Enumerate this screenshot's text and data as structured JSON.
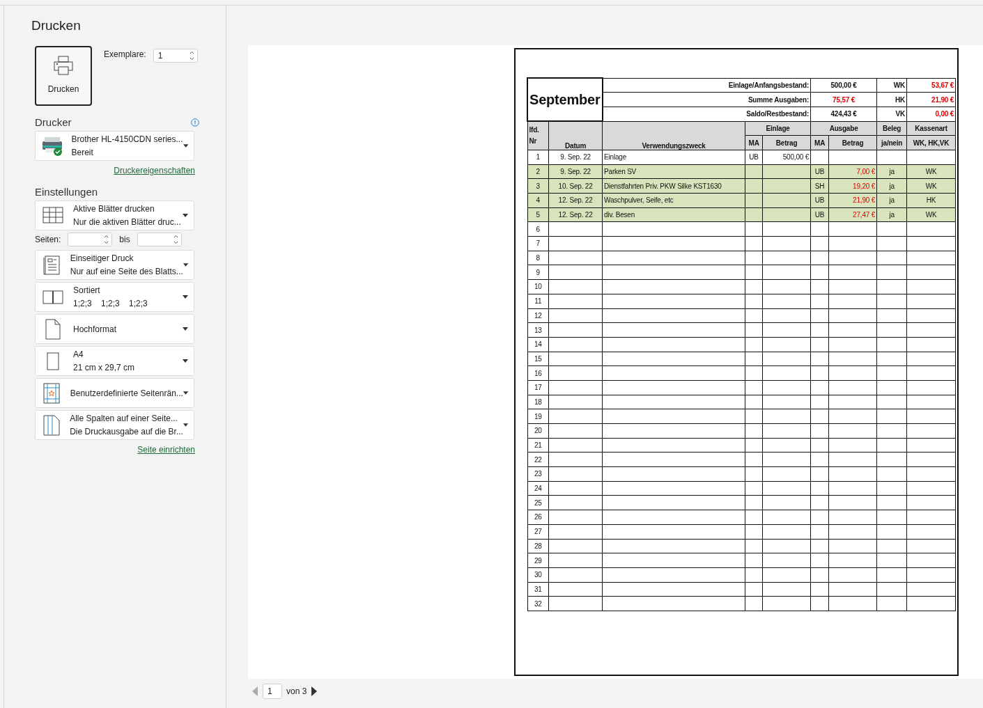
{
  "title": "Drucken",
  "print_button": {
    "label": "Drucken"
  },
  "copies": {
    "label": "Exemplare:",
    "value": "1"
  },
  "printer": {
    "heading": "Drucker",
    "name": "Brother HL-4150CDN series...",
    "status": "Bereit",
    "ready": true,
    "link": "Druckereigenschaften"
  },
  "settings": {
    "heading": "Einstellungen",
    "items": [
      {
        "kind": "sheets",
        "title": "Aktive Blätter drucken",
        "subtitle": "Nur die aktiven Blätter druc..."
      },
      {
        "kind": "pages",
        "from_label": "Seiten:",
        "to_label": "bis"
      },
      {
        "kind": "sides",
        "title": "Einseitiger Druck",
        "subtitle": "Nur auf eine Seite des Blatts..."
      },
      {
        "kind": "collate",
        "title": "Sortiert",
        "subtitle": "1;2;3    1;2;3    1;2;3"
      },
      {
        "kind": "orientation",
        "title": "Hochformat"
      },
      {
        "kind": "paper",
        "title": "A4",
        "subtitle": "21 cm x 29,7 cm"
      },
      {
        "kind": "margins",
        "title": "Benutzerdefinierte Seitenrän..."
      },
      {
        "kind": "scaling",
        "title": "Alle Spalten auf einer Seite...",
        "subtitle": "Die Druckausgabe auf die Br..."
      }
    ],
    "link": "Seite einrichten"
  },
  "sheet": {
    "month": "September",
    "summary": [
      {
        "label": "Einlage/Anfangsbestand:",
        "value": "500,00 €",
        "negative": false,
        "kasse": "WK",
        "kasse_value": "53,67 €"
      },
      {
        "label": "Summe Ausgaben:",
        "value": "75,57 €",
        "negative": true,
        "kasse": "HK",
        "kasse_value": "21,90 €"
      },
      {
        "label": "Saldo/Restbestand:",
        "value": "424,43 €",
        "negative": false,
        "kasse": "VK",
        "kasse_value": "0,00 €"
      }
    ],
    "headers": {
      "nr": "lfd. Nr",
      "datum": "Datum",
      "zweck": "Verwendungszweck",
      "einlage": "Einlage",
      "ausgabe": "Ausgabe",
      "beleg": "Beleg",
      "kassenart": "Kassenart",
      "ma": "MA",
      "betrag": "Betrag",
      "ma_2": "MA",
      "betrag_2": "Betrag",
      "janein": "ja/nein",
      "kassen": "WK, HK,VK"
    },
    "rows": [
      {
        "nr": "1",
        "datum": "9. Sep. 22",
        "zweck": "Einlage",
        "einlage_ma": "UB",
        "einlage_betrag": "500,00 €",
        "highlighted": false
      },
      {
        "nr": "2",
        "datum": "9. Sep. 22",
        "zweck": "Parken SV",
        "ausgabe_ma": "UB",
        "ausgabe_betrag": "7,00 €",
        "beleg": "ja",
        "kassenart": "WK",
        "highlighted": true
      },
      {
        "nr": "3",
        "datum": "10. Sep. 22",
        "zweck": "Dienstfahrten Priv. PKW Silke KST1630",
        "ausgabe_ma": "SH",
        "ausgabe_betrag": "19,20 €",
        "beleg": "ja",
        "kassenart": "WK",
        "highlighted": true
      },
      {
        "nr": "4",
        "datum": "12. Sep. 22",
        "zweck": "Waschpulver, Seife, etc",
        "ausgabe_ma": "UB",
        "ausgabe_betrag": "21,90 €",
        "beleg": "ja",
        "kassenart": "HK",
        "highlighted": true
      },
      {
        "nr": "5",
        "datum": "12. Sep. 22",
        "zweck": "div. Besen",
        "ausgabe_ma": "UB",
        "ausgabe_betrag": "27,47 €",
        "beleg": "ja",
        "kassenart": "WK",
        "highlighted": true
      },
      {
        "nr": "6",
        "highlighted": false
      },
      {
        "nr": "7",
        "highlighted": false
      },
      {
        "nr": "8",
        "highlighted": false
      },
      {
        "nr": "9",
        "highlighted": false
      },
      {
        "nr": "10",
        "highlighted": false
      },
      {
        "nr": "11",
        "highlighted": false
      },
      {
        "nr": "12",
        "highlighted": false
      },
      {
        "nr": "13",
        "highlighted": false
      },
      {
        "nr": "14",
        "highlighted": false
      },
      {
        "nr": "15",
        "highlighted": false
      },
      {
        "nr": "16",
        "highlighted": false
      },
      {
        "nr": "17",
        "highlighted": false
      },
      {
        "nr": "18",
        "highlighted": false
      },
      {
        "nr": "19",
        "highlighted": false
      },
      {
        "nr": "20",
        "highlighted": false
      },
      {
        "nr": "21",
        "highlighted": false
      },
      {
        "nr": "22",
        "highlighted": false
      },
      {
        "nr": "23",
        "highlighted": false
      },
      {
        "nr": "24",
        "highlighted": false
      },
      {
        "nr": "25",
        "highlighted": false
      },
      {
        "nr": "26",
        "highlighted": false
      },
      {
        "nr": "27",
        "highlighted": false
      },
      {
        "nr": "28",
        "highlighted": false
      },
      {
        "nr": "29",
        "highlighted": false
      },
      {
        "nr": "30",
        "highlighted": false
      },
      {
        "nr": "31",
        "highlighted": false
      },
      {
        "nr": "32",
        "highlighted": false
      }
    ]
  },
  "pager": {
    "page": "1",
    "total": "von 3",
    "prev_disabled": true,
    "next_disabled": false
  }
}
